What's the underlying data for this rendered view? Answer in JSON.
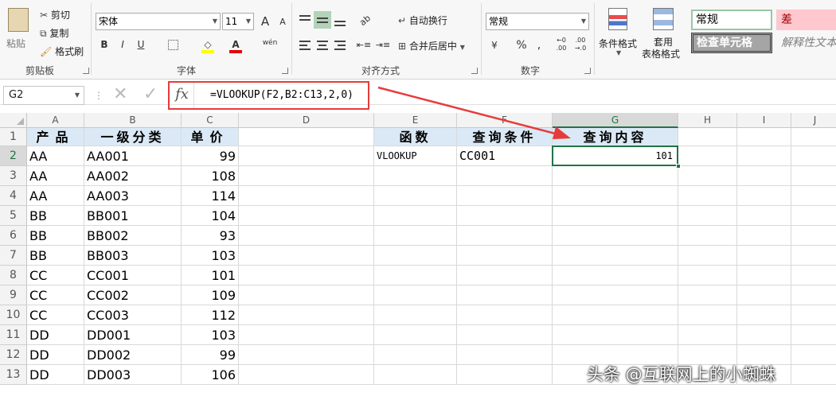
{
  "ribbon": {
    "clipboard": {
      "paste": "粘贴",
      "cut": "剪切",
      "copy": "复制",
      "format_painter": "格式刷",
      "group": "剪贴板"
    },
    "font": {
      "name": "宋体",
      "size": "11",
      "group": "字体",
      "grow": "A",
      "shrink": "A",
      "bold": "B",
      "italic": "I",
      "underline": "U",
      "phonetic": "wén"
    },
    "alignment": {
      "wrap": "自动换行",
      "merge": "合并后居中",
      "group": "对齐方式"
    },
    "number": {
      "format": "常规",
      "percent": "%",
      "comma": ",",
      "group": "数字",
      "currency": "¥"
    },
    "styles": {
      "conditional": "条件格式",
      "table_line1": "套用",
      "table_line2": "表格格式",
      "normal": "常规",
      "bad": "差",
      "check": "检查单元格",
      "explanatory": "解释性文本"
    }
  },
  "formula_bar": {
    "name_box": "G2",
    "fx": "fx",
    "formula": "=VLOOKUP(F2,B2:C13,2,0)"
  },
  "columns": [
    "A",
    "B",
    "C",
    "D",
    "E",
    "F",
    "G",
    "H",
    "I",
    "J"
  ],
  "rows": [
    "1",
    "2",
    "3",
    "4",
    "5",
    "6",
    "7",
    "8",
    "9",
    "10",
    "11",
    "12",
    "13"
  ],
  "sheet": {
    "headers": {
      "A": "产品",
      "B": "一级分类",
      "C": "单价",
      "E": "函数",
      "F": "查询条件",
      "G": "查询内容"
    },
    "data": [
      [
        "AA",
        "AA001",
        "99"
      ],
      [
        "AA",
        "AA002",
        "108"
      ],
      [
        "AA",
        "AA003",
        "114"
      ],
      [
        "BB",
        "BB001",
        "104"
      ],
      [
        "BB",
        "BB002",
        "93"
      ],
      [
        "BB",
        "BB003",
        "103"
      ],
      [
        "CC",
        "CC001",
        "101"
      ],
      [
        "CC",
        "CC002",
        "109"
      ],
      [
        "CC",
        "CC003",
        "112"
      ],
      [
        "DD",
        "DD001",
        "103"
      ],
      [
        "DD",
        "DD002",
        "99"
      ],
      [
        "DD",
        "DD003",
        "106"
      ]
    ],
    "lookup": {
      "func": "VLOOKUP",
      "cond": "CC001",
      "result": "101"
    }
  },
  "watermark": "头条 @互联网上的小蜘蛛",
  "colors": {
    "header_fill": "#dbe9f6",
    "annotation": "#e63b3b",
    "selection": "#217346"
  }
}
